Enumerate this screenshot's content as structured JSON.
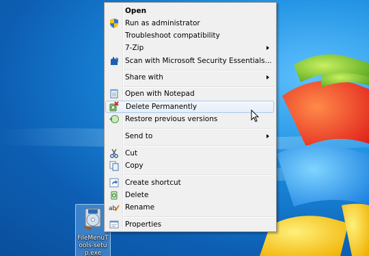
{
  "desktop": {
    "icon_label": "FileMenuTools-setup.exe"
  },
  "menu": {
    "items": [
      {
        "label": "Open",
        "icon": "none",
        "submenu": false
      },
      {
        "label": "Run as administrator",
        "icon": "uac-shield-icon",
        "submenu": false
      },
      {
        "label": "Troubleshoot compatibility",
        "icon": "none",
        "submenu": false
      },
      {
        "label": "7-Zip",
        "icon": "none",
        "submenu": true
      },
      {
        "label": "Scan with Microsoft Security Essentials...",
        "icon": "security-essentials-icon",
        "submenu": false
      },
      {
        "label": "Share with",
        "icon": "none",
        "submenu": true
      },
      {
        "label": "Open with Notepad",
        "icon": "notepad-icon",
        "submenu": false
      },
      {
        "label": "Delete Permanently",
        "icon": "delete-permanently-icon",
        "submenu": false
      },
      {
        "label": "Restore previous versions",
        "icon": "restore-icon",
        "submenu": false
      },
      {
        "label": "Send to",
        "icon": "none",
        "submenu": true
      },
      {
        "label": "Cut",
        "icon": "scissors-icon",
        "submenu": false
      },
      {
        "label": "Copy",
        "icon": "copy-icon",
        "submenu": false
      },
      {
        "label": "Create shortcut",
        "icon": "shortcut-icon",
        "submenu": false
      },
      {
        "label": "Delete",
        "icon": "recycle-icon",
        "submenu": false
      },
      {
        "label": "Rename",
        "icon": "rename-icon",
        "submenu": false
      },
      {
        "label": "Properties",
        "icon": "properties-icon",
        "submenu": false
      }
    ],
    "hovered_item": "Delete Permanently"
  },
  "colors": {
    "menu_bg": "#f0f0f0",
    "hover_border": "#a8c8ea",
    "desktop_blue": "#0f6fc0"
  }
}
